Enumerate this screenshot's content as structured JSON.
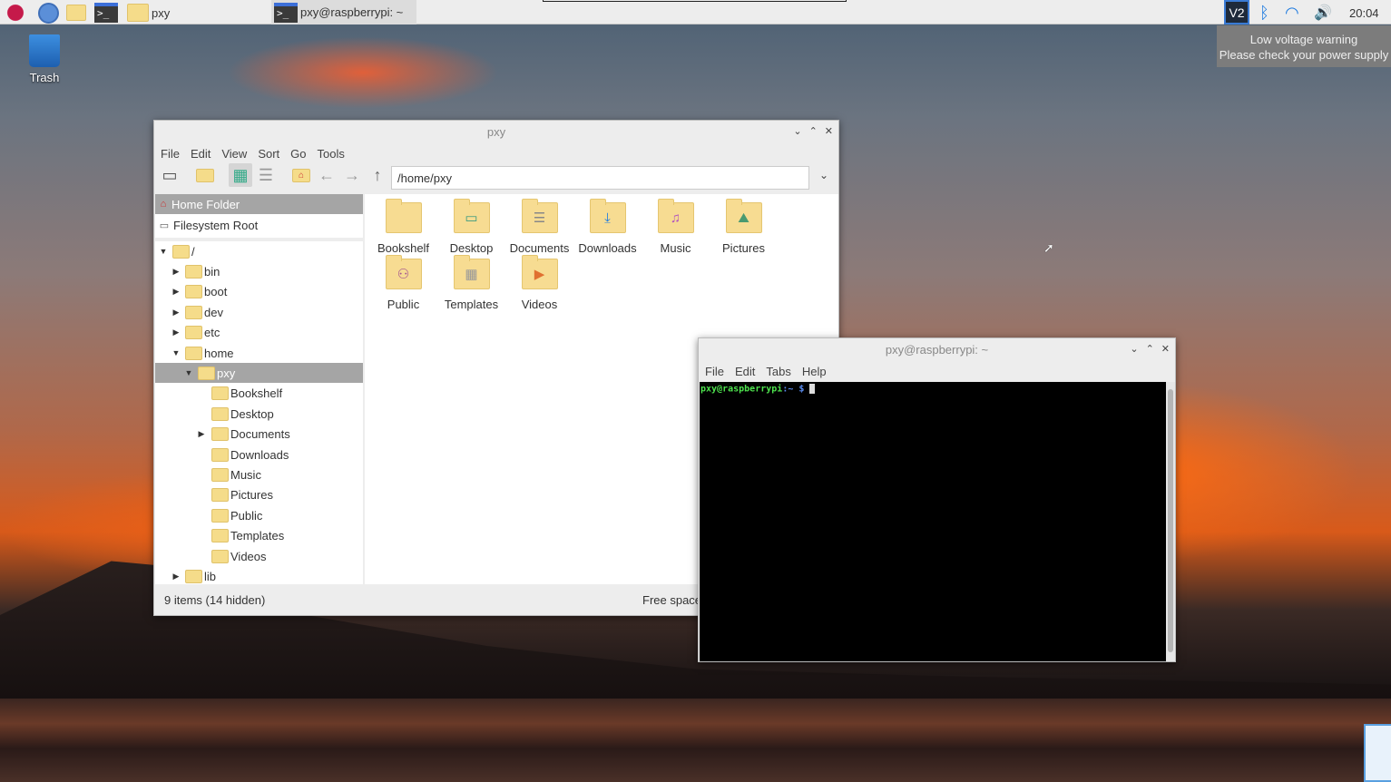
{
  "taskbar": {
    "apps": [
      {
        "label": "pxy",
        "icon": "folder-icon"
      },
      {
        "label": "pxy@raspberrypi: ~",
        "icon": "terminal-icon"
      }
    ],
    "clock": "20:04"
  },
  "notification": {
    "line1": "Low voltage warning",
    "line2": "Please check your power supply"
  },
  "desktop": {
    "trash_label": "Trash"
  },
  "file_manager": {
    "title": "pxy",
    "menu": [
      "File",
      "Edit",
      "View",
      "Sort",
      "Go",
      "Tools"
    ],
    "path": "/home/pxy",
    "places": [
      "Home Folder",
      "Filesystem Root"
    ],
    "tree": [
      {
        "label": "/",
        "depth": 0,
        "arrow": "open"
      },
      {
        "label": "bin",
        "depth": 1,
        "arrow": "closed"
      },
      {
        "label": "boot",
        "depth": 1,
        "arrow": "closed"
      },
      {
        "label": "dev",
        "depth": 1,
        "arrow": "closed"
      },
      {
        "label": "etc",
        "depth": 1,
        "arrow": "closed"
      },
      {
        "label": "home",
        "depth": 1,
        "arrow": "open"
      },
      {
        "label": "pxy",
        "depth": 2,
        "arrow": "open",
        "selected": true
      },
      {
        "label": "Bookshelf",
        "depth": 3,
        "arrow": ""
      },
      {
        "label": "Desktop",
        "depth": 3,
        "arrow": ""
      },
      {
        "label": "Documents",
        "depth": 3,
        "arrow": "closed"
      },
      {
        "label": "Downloads",
        "depth": 3,
        "arrow": ""
      },
      {
        "label": "Music",
        "depth": 3,
        "arrow": ""
      },
      {
        "label": "Pictures",
        "depth": 3,
        "arrow": ""
      },
      {
        "label": "Public",
        "depth": 3,
        "arrow": ""
      },
      {
        "label": "Templates",
        "depth": 3,
        "arrow": ""
      },
      {
        "label": "Videos",
        "depth": 3,
        "arrow": ""
      },
      {
        "label": "lib",
        "depth": 1,
        "arrow": "closed"
      }
    ],
    "items": [
      {
        "label": "Bookshelf",
        "icon": "folder-icon"
      },
      {
        "label": "Desktop",
        "icon": "desktop-folder-icon"
      },
      {
        "label": "Documents",
        "icon": "documents-folder-icon"
      },
      {
        "label": "Downloads",
        "icon": "downloads-folder-icon"
      },
      {
        "label": "Music",
        "icon": "music-folder-icon"
      },
      {
        "label": "Pictures",
        "icon": "pictures-folder-icon"
      },
      {
        "label": "Public",
        "icon": "public-folder-icon"
      },
      {
        "label": "Templates",
        "icon": "templates-folder-icon"
      },
      {
        "label": "Videos",
        "icon": "videos-folder-icon"
      }
    ],
    "status_left": "9 items (14 hidden)",
    "status_right": "Free space"
  },
  "terminal": {
    "title": "pxy@raspberrypi: ~",
    "menu": [
      "File",
      "Edit",
      "Tabs",
      "Help"
    ],
    "prompt_user": "pxy@raspberrypi",
    "prompt_path": ":~ $",
    "prompt_color": "#4ee44e"
  }
}
